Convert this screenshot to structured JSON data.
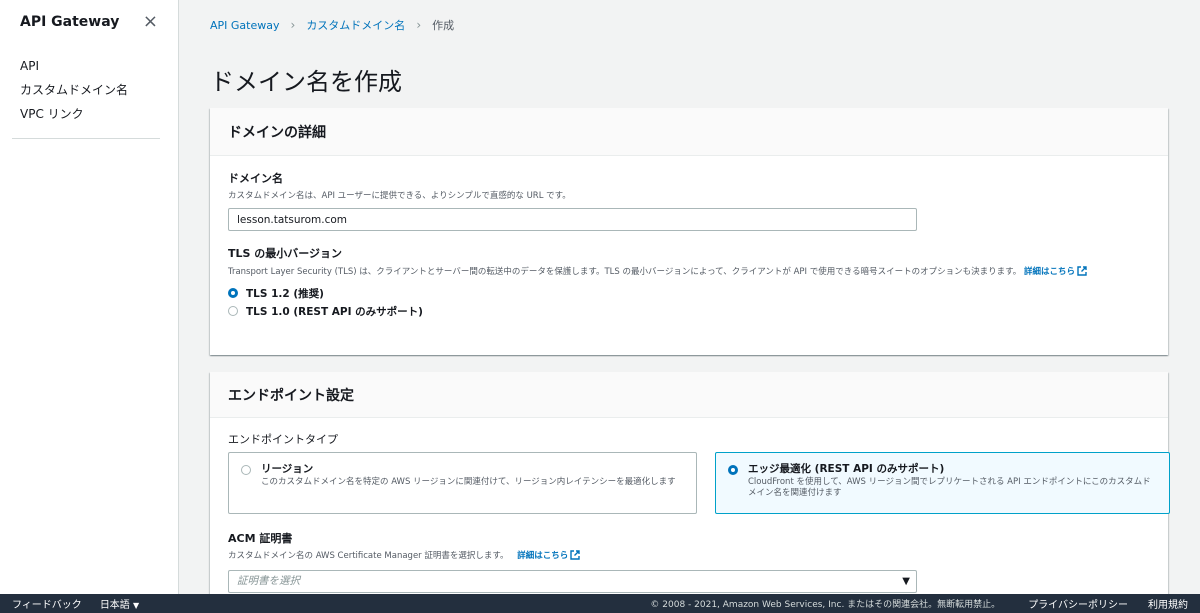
{
  "sidebar": {
    "title": "API Gateway",
    "close_icon": "×",
    "items": [
      {
        "label": "API"
      },
      {
        "label": "カスタムドメイン名"
      },
      {
        "label": "VPC リンク"
      }
    ]
  },
  "breadcrumb": {
    "items": [
      "API Gateway",
      "カスタムドメイン名"
    ],
    "current": "作成"
  },
  "page": {
    "title": "ドメイン名を作成"
  },
  "domain_details": {
    "heading": "ドメインの詳細",
    "domain_name": {
      "label": "ドメイン名",
      "description": "カスタムドメイン名は、API ユーザーに提供できる、よりシンプルで直感的な URL です。",
      "value": "lesson.tatsurom.com"
    },
    "tls": {
      "label": "TLS の最小バージョン",
      "description": "Transport Layer Security (TLS) は、クライアントとサーバー間の転送中のデータを保護します。TLS の最小バージョンによって、クライアントが API で使用できる暗号スイートのオプションも決まります。",
      "link": "詳細はこちら",
      "options": [
        {
          "label": "TLS 1.2 (推奨)",
          "selected": true
        },
        {
          "label": "TLS 1.0 (REST API のみサポート)",
          "selected": false
        }
      ]
    }
  },
  "endpoint_settings": {
    "heading": "エンドポイント設定",
    "type_label": "エンドポイントタイプ",
    "types": [
      {
        "title": "リージョン",
        "description": "このカスタムドメイン名を特定の AWS リージョンに関連付けて、リージョン内レイテンシーを最適化します",
        "selected": false
      },
      {
        "title": "エッジ最適化 (REST API のみサポート)",
        "description": "CloudFront を使用して、AWS リージョン間でレプリケートされる API エンドポイントにこのカスタムドメイン名を関連付けます",
        "selected": true
      }
    ],
    "acm": {
      "label": "ACM 証明書",
      "description": "カスタムドメイン名の AWS Certificate Manager 証明書を選択します。",
      "link": "詳細はこちら",
      "placeholder": "証明書を選択"
    }
  },
  "footer": {
    "feedback": "フィードバック",
    "language": "日本語",
    "copyright": "© 2008 - 2021, Amazon Web Services, Inc. またはその関連会社。無断転用禁止。",
    "privacy": "プライバシーポリシー",
    "terms": "利用規約"
  },
  "colors": {
    "link": "#0073bb",
    "selected_border": "#00a1c9",
    "footer_bg": "#232f3e"
  }
}
